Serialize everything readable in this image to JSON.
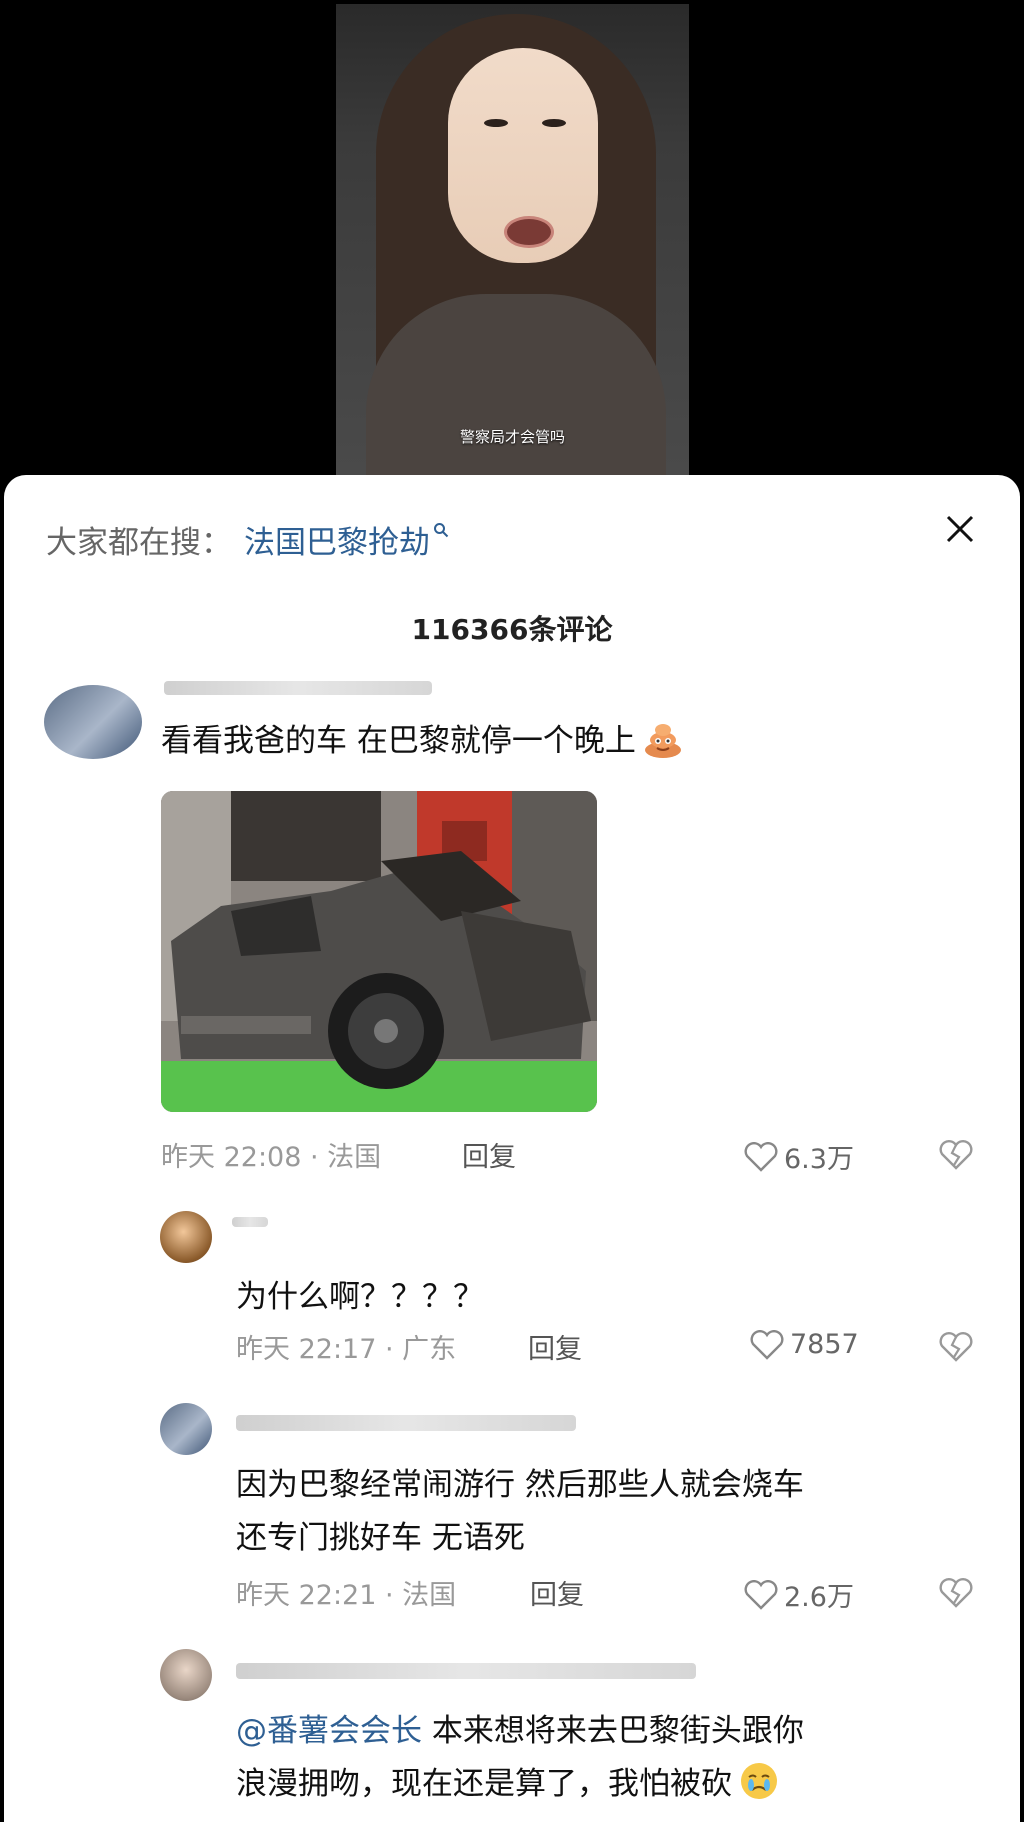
{
  "video": {
    "caption": "警察局才会管吗"
  },
  "sheet": {
    "search_prefix": "大家都在搜：",
    "search_term": "法国巴黎抢劫",
    "comment_count": "116366条评论"
  },
  "icons": {
    "search": "search-icon",
    "close": "close-icon",
    "like": "heart-outline-icon",
    "dislike": "broken-heart-icon",
    "emoji_poop": "poop-emoji-icon",
    "emoji_cry": "crying-emoji-icon"
  },
  "comments": [
    {
      "text": "看看我爸的车 在巴黎就停一个晚上",
      "time_location": "昨天 22:08 · 法国",
      "reply": "回复",
      "likes": "6.3万"
    },
    {
      "text": "为什么啊？？？？",
      "time_location": "昨天 22:17 · 广东",
      "reply": "回复",
      "likes": "7857"
    },
    {
      "text_line1": "因为巴黎经常闹游行 然后那些人就会烧车",
      "text_line2": "还专门挑好车 无语死",
      "time_location": "昨天 22:21 · 法国",
      "reply": "回复",
      "likes": "2.6万"
    },
    {
      "mention": "@番薯会会长",
      "text_line1": " 本来想将来去巴黎街头跟你",
      "text_line2": "浪漫拥吻，现在还是算了，我怕被砍"
    }
  ],
  "colors": {
    "link_blue": "#2e5f93",
    "meta_gray": "#999999",
    "background": "#ffffff"
  }
}
